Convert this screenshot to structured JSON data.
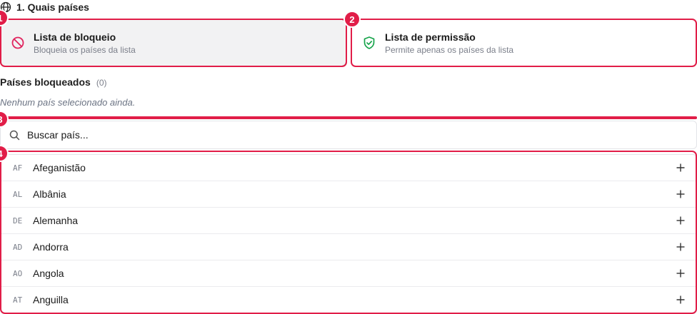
{
  "section": {
    "title": "1. Quais países",
    "icon": "globe-icon"
  },
  "options": {
    "block": {
      "title": "Lista de bloqueio",
      "description": "Bloqueia os países da lista",
      "icon": "ban-icon",
      "selected": true
    },
    "allow": {
      "title": "Lista de permissão",
      "description": "Permite apenas os países da lista",
      "icon": "shield-check-icon",
      "selected": false
    }
  },
  "blocked": {
    "title": "Países bloqueados",
    "count": "(0)",
    "empty_text": "Nenhum país selecionado ainda."
  },
  "search": {
    "placeholder": "Buscar país...",
    "value": ""
  },
  "countries": [
    {
      "code": "AF",
      "name": "Afeganistão"
    },
    {
      "code": "AL",
      "name": "Albânia"
    },
    {
      "code": "DE",
      "name": "Alemanha"
    },
    {
      "code": "AD",
      "name": "Andorra"
    },
    {
      "code": "AO",
      "name": "Angola"
    },
    {
      "code": "AT",
      "name": "Anguilla"
    }
  ],
  "markers": [
    "1",
    "2",
    "3",
    "4"
  ],
  "colors": {
    "highlight": "#e11d48",
    "ban_icon": "#e0245e",
    "shield_icon": "#16a34a",
    "muted_text": "#7b7f8a"
  }
}
